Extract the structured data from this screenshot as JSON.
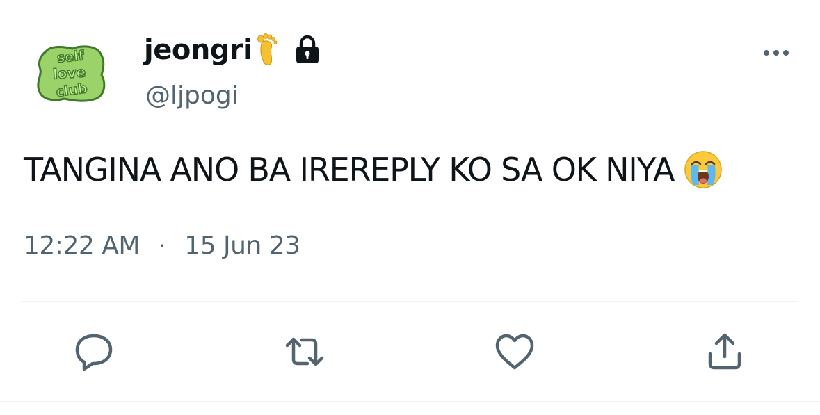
{
  "author": {
    "display_name": "jeongri",
    "handle": "@ljpogi",
    "avatar_text": "self love club"
  },
  "tweet": {
    "text": "TANGINA ANO BA IREREPLY KO SA OK NIYA",
    "time": "12:22 AM",
    "separator": "·",
    "date": "15 Jun 23"
  },
  "icons": {
    "name_emoji": "foot-icon",
    "protected": "lock-icon",
    "text_emoji": "loudly-crying-face-icon",
    "more": "more-horizontal-icon",
    "actions": [
      "reply-icon",
      "retweet-icon",
      "like-icon",
      "share-icon"
    ]
  },
  "colors": {
    "text_primary": "#0f1419",
    "text_secondary": "#536471",
    "icon_gray": "#536471",
    "divider": "#eff3f4",
    "avatar_green": "#9bd36a",
    "avatar_dark_green": "#3e7a2a"
  }
}
